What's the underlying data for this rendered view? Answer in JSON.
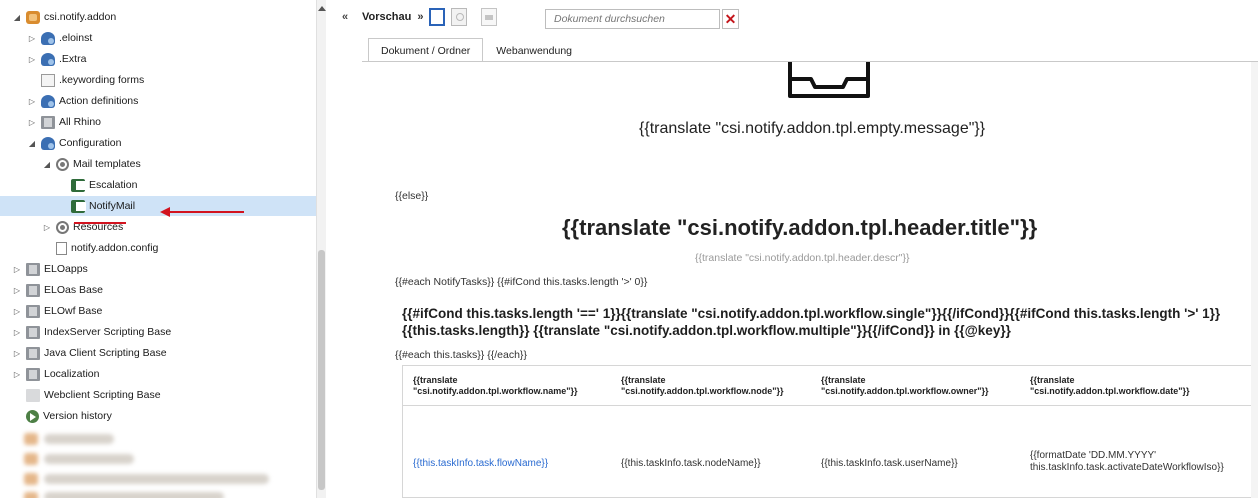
{
  "tree": {
    "items": [
      {
        "label": "csi.notify.addon",
        "toggle": "◢",
        "icon": "addon-icon",
        "indent": 0
      },
      {
        "label": ".eloinst",
        "toggle": "▷",
        "icon": "repository-folder-icon",
        "indent": 1
      },
      {
        "label": ".Extra",
        "toggle": "▷",
        "icon": "repository-folder-icon",
        "indent": 1
      },
      {
        "label": ".keywording forms",
        "toggle": "",
        "icon": "form-icon",
        "indent": 1
      },
      {
        "label": "Action definitions",
        "toggle": "▷",
        "icon": "repository-folder-icon",
        "indent": 1
      },
      {
        "label": "All Rhino",
        "toggle": "▷",
        "icon": "gray-folder-icon",
        "indent": 1
      },
      {
        "label": "Configuration",
        "toggle": "◢",
        "icon": "repository-folder-icon",
        "indent": 1
      },
      {
        "label": "Mail templates",
        "toggle": "◢",
        "icon": "gear-folder-icon",
        "indent": 2
      },
      {
        "label": "Escalation",
        "toggle": "",
        "icon": "mail-template-icon",
        "indent": 3
      },
      {
        "label": "NotifyMail",
        "toggle": "",
        "icon": "mail-template-icon",
        "indent": 3,
        "selected": true
      },
      {
        "label": "Resources",
        "toggle": "▷",
        "icon": "gear-folder-icon",
        "indent": 2
      },
      {
        "label": "notify.addon.config",
        "toggle": "",
        "icon": "document-icon",
        "indent": 2
      },
      {
        "label": "ELOapps",
        "toggle": "▷",
        "icon": "gray-folder-icon",
        "indent": 0
      },
      {
        "label": "ELOas Base",
        "toggle": "▷",
        "icon": "gray-folder-icon",
        "indent": 0
      },
      {
        "label": "ELOwf Base",
        "toggle": "▷",
        "icon": "gray-folder-icon",
        "indent": 0
      },
      {
        "label": "IndexServer Scripting Base",
        "toggle": "▷",
        "icon": "gray-folder-icon",
        "indent": 0
      },
      {
        "label": "Java Client Scripting Base",
        "toggle": "▷",
        "icon": "gray-folder-icon",
        "indent": 0
      },
      {
        "label": "Localization",
        "toggle": "▷",
        "icon": "gray-folder-icon",
        "indent": 0
      },
      {
        "label": "Webclient Scripting Base",
        "toggle": "",
        "icon": "light-folder-icon",
        "indent": 0
      },
      {
        "label": "Version history",
        "toggle": "",
        "icon": "version-history-icon",
        "indent": 0
      }
    ]
  },
  "toolbar": {
    "collapse": "«",
    "title": "Vorschau",
    "expand": "»",
    "search_placeholder": "Dokument durchsuchen",
    "clear": "✕"
  },
  "tabs": [
    {
      "label": "Dokument / Ordner",
      "active": true
    },
    {
      "label": "Webanwendung",
      "active": false
    }
  ],
  "preview": {
    "empty_message": "{{translate \"csi.notify.addon.tpl.empty.message\"}}",
    "else_tag": "{{else}}",
    "header_title": "{{translate \"csi.notify.addon.tpl.header.title\"}}",
    "header_descr": "{{translate \"csi.notify.addon.tpl.header.descr\"}}",
    "each_tasks": "{{#each NotifyTasks}} {{#ifCond this.tasks.length '>' 0}}",
    "workflow_line": "{{#ifCond this.tasks.length '==' 1}}{{translate \"csi.notify.addon.tpl.workflow.single\"}}{{/ifCond}}{{#ifCond this.tasks.length '>' 1}}{{this.tasks.length}} {{translate \"csi.notify.addon.tpl.workflow.multiple\"}}{{/ifCond}} in {{@key}}",
    "each_this": "{{#each this.tasks}} {{/each}}",
    "table": {
      "headers": [
        [
          "{{translate",
          "\"csi.notify.addon.tpl.workflow.name\"}}"
        ],
        [
          "{{translate",
          "\"csi.notify.addon.tpl.workflow.node\"}}"
        ],
        [
          "{{translate",
          "\"csi.notify.addon.tpl.workflow.owner\"}}"
        ],
        [
          "{{translate",
          "\"csi.notify.addon.tpl.workflow.date\"}}"
        ]
      ],
      "row": [
        "{{this.taskInfo.task.flowName}}",
        "{{this.taskInfo.task.nodeName}}",
        "{{this.taskInfo.task.userName}}",
        [
          "{{formatDate 'DD.MM.YYYY'",
          "this.taskInfo.task.activateDateWorkflowIso}}"
        ]
      ]
    }
  },
  "colors": {
    "selection": "#cfe3f7",
    "annotation": "#d2131f",
    "link": "#2a6bd1"
  }
}
